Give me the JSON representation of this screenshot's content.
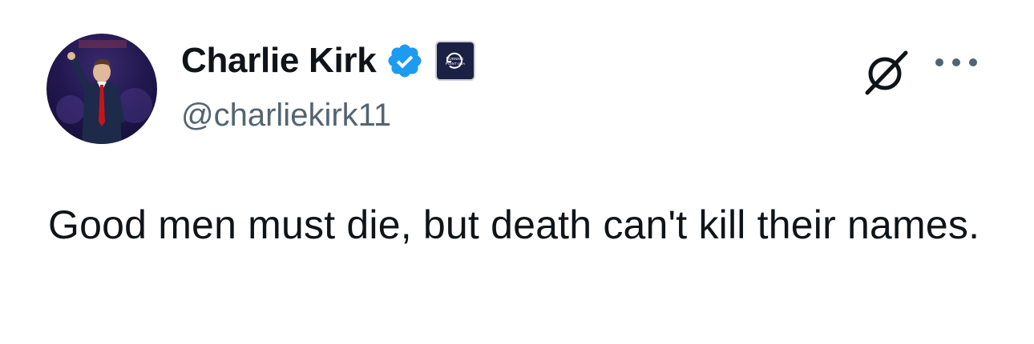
{
  "author": {
    "display_name": "Charlie Kirk",
    "handle": "@charliekirk11",
    "avatar_icon": "profile-photo",
    "verified_icon": "verified-badge-icon",
    "verified_color": "#1d9bf0",
    "affiliate_icon": "turning-point-usa-logo",
    "affiliate_logo_text": "TURNING POINT USA"
  },
  "actions": {
    "grok_icon": "grok-icon",
    "more_icon": "more-options-icon"
  },
  "tweet": {
    "text": "Good men must die, but death can't kill their names."
  },
  "colors": {
    "text_primary": "#0f1419",
    "text_secondary": "#536471",
    "verified_blue": "#1d9bf0",
    "background": "#ffffff"
  }
}
